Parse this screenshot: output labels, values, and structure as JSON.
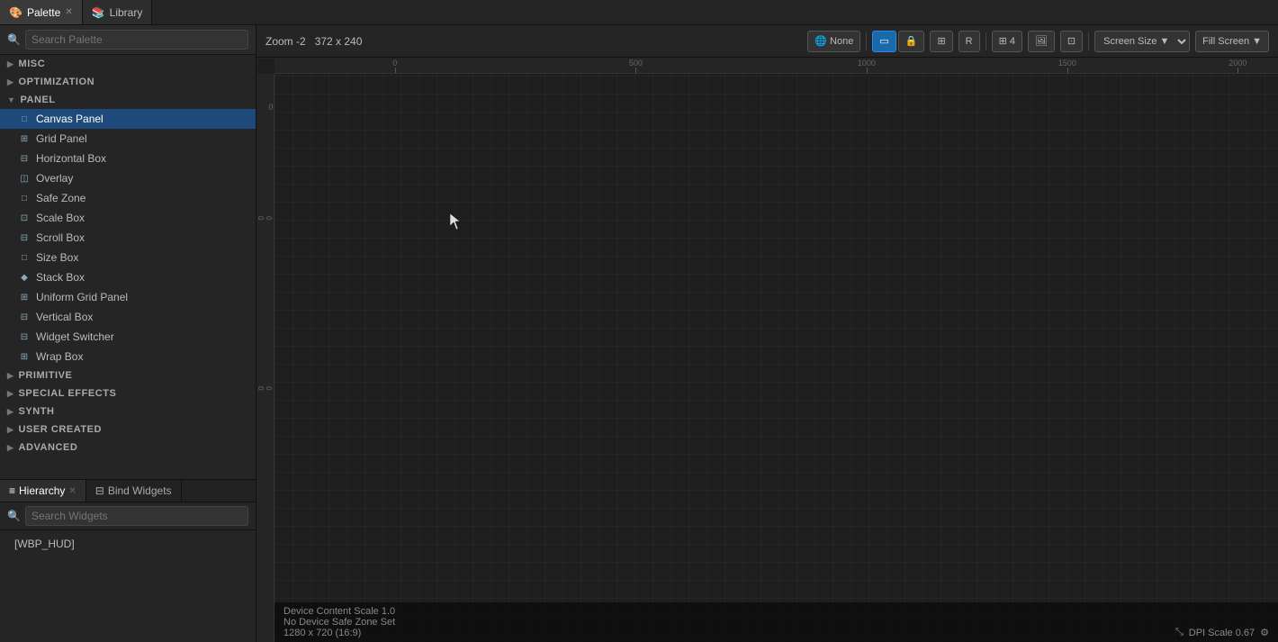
{
  "tabs": [
    {
      "id": "palette",
      "label": "Palette",
      "icon": "palette-icon",
      "closable": true,
      "active": true
    },
    {
      "id": "library",
      "label": "Library",
      "icon": "library-icon",
      "closable": false,
      "active": false
    }
  ],
  "palette": {
    "search_placeholder": "Search Palette",
    "categories": [
      {
        "id": "misc",
        "label": "MISC",
        "expanded": false,
        "items": []
      },
      {
        "id": "optimization",
        "label": "OPTIMIZATION",
        "expanded": false,
        "items": []
      },
      {
        "id": "panel",
        "label": "PANEL",
        "expanded": true,
        "items": [
          {
            "id": "canvas-panel",
            "label": "Canvas Panel",
            "icon": "□",
            "selected": true
          },
          {
            "id": "grid-panel",
            "label": "Grid Panel",
            "icon": "⊞"
          },
          {
            "id": "horizontal-box",
            "label": "Horizontal Box",
            "icon": "⊟"
          },
          {
            "id": "overlay",
            "label": "Overlay",
            "icon": "◫"
          },
          {
            "id": "safe-zone",
            "label": "Safe Zone",
            "icon": "□"
          },
          {
            "id": "scale-box",
            "label": "Scale Box",
            "icon": "⊡"
          },
          {
            "id": "scroll-box",
            "label": "Scroll Box",
            "icon": "⊟"
          },
          {
            "id": "size-box",
            "label": "Size Box",
            "icon": "□"
          },
          {
            "id": "stack-box",
            "label": "Stack Box",
            "icon": "◆"
          },
          {
            "id": "uniform-grid-panel",
            "label": "Uniform Grid Panel",
            "icon": "⊞"
          },
          {
            "id": "vertical-box",
            "label": "Vertical Box",
            "icon": "⊟"
          },
          {
            "id": "widget-switcher",
            "label": "Widget Switcher",
            "icon": "⊟"
          },
          {
            "id": "wrap-box",
            "label": "Wrap Box",
            "icon": "⊞"
          }
        ]
      },
      {
        "id": "primitive",
        "label": "PRIMITIVE",
        "expanded": false,
        "items": []
      },
      {
        "id": "special-effects",
        "label": "SPECIAL EFFECTS",
        "expanded": false,
        "items": []
      },
      {
        "id": "synth",
        "label": "SYNTH",
        "expanded": false,
        "items": []
      },
      {
        "id": "user-created",
        "label": "USER CREATED",
        "expanded": false,
        "items": []
      },
      {
        "id": "advanced",
        "label": "ADVANCED",
        "expanded": false,
        "items": []
      }
    ]
  },
  "hierarchy": {
    "tabs": [
      {
        "id": "hierarchy",
        "label": "Hierarchy",
        "icon": "≡",
        "closable": true,
        "active": true
      },
      {
        "id": "bind-widgets",
        "label": "Bind Widgets",
        "icon": "⊟",
        "closable": false,
        "active": false
      }
    ],
    "search_placeholder": "Search Widgets",
    "items": [
      {
        "id": "wbp-hud",
        "label": "[WBP_HUD]"
      }
    ]
  },
  "canvas": {
    "zoom_label": "Zoom -2",
    "dims_label": "372 x 240",
    "toolbar": {
      "globe_label": "None",
      "r_label": "R",
      "grid_count": "4",
      "screen_size_label": "Screen Size",
      "fill_screen_label": "Fill Screen"
    },
    "status": {
      "line1": "Device Content Scale 1.0",
      "line2": "No Device Safe Zone Set",
      "line3": "1280 x 720 (16:9)"
    },
    "dpi_label": "DPI Scale 0.67"
  },
  "ruler": {
    "top_ticks": [
      "0",
      "500",
      "1000",
      "1500",
      "2000"
    ],
    "top_positions": [
      "12",
      "182",
      "353",
      "523",
      "693"
    ],
    "left_ticks": [
      "0",
      "500"
    ],
    "left_positions": [
      "12",
      "140"
    ]
  },
  "icons": {
    "palette": "🎨",
    "library": "📚",
    "search": "🔍",
    "close": "✕",
    "arrow_down": "▼",
    "arrow_right": "▶",
    "globe": "🌐",
    "lock": "🔒",
    "unlock": "🔓",
    "grid": "⊞",
    "resize": "⤡",
    "settings": "⚙"
  }
}
